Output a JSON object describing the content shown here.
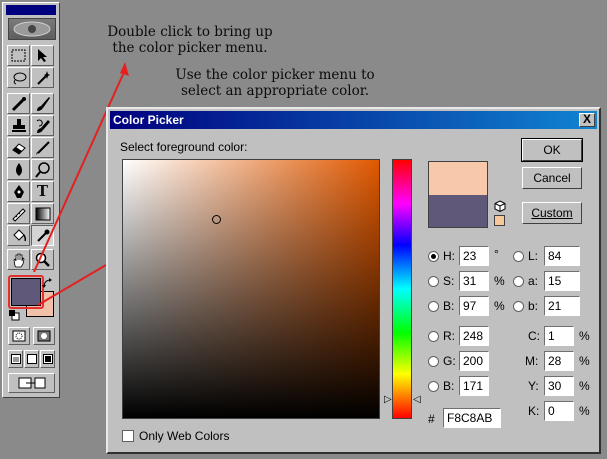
{
  "annotations": {
    "double_click": "Double click to bring up\nthe color picker menu.",
    "use_picker": "Use the color picker menu to\nselect an appropriate color."
  },
  "toolbox": {
    "tools": [
      "marquee-tool",
      "move-tool",
      "lasso-tool",
      "magic-wand-tool",
      "airbrush-tool",
      "paintbrush-tool",
      "rubber-stamp-tool",
      "history-brush-tool",
      "eraser-tool",
      "pencil-tool",
      "blur-tool",
      "dodge-tool",
      "pen-tool",
      "type-tool",
      "measure-tool",
      "gradient-tool",
      "paint-bucket-tool",
      "eyedropper-tool",
      "hand-tool",
      "zoom-tool"
    ],
    "type_tool_glyph": "T"
  },
  "dialog": {
    "title": "Color Picker",
    "close_glyph": "X",
    "prompt": "Select foreground color:",
    "buttons": {
      "ok": "OK",
      "cancel": "Cancel",
      "custom": "Custom"
    },
    "hsb": {
      "h_label": "H:",
      "h_value": "23",
      "h_unit": "°",
      "s_label": "S:",
      "s_value": "31",
      "s_unit": "%",
      "b_label": "B:",
      "b_value": "97",
      "b_unit": "%"
    },
    "rgb": {
      "r_label": "R:",
      "r_value": "248",
      "g_label": "G:",
      "g_value": "200",
      "b_label": "B:",
      "b_value": "171"
    },
    "lab": {
      "l_label": "L:",
      "l_value": "84",
      "a_label": "a:",
      "a_value": "15",
      "b_label": "b:",
      "b_value": "21"
    },
    "cmyk": {
      "c_label": "C:",
      "c_value": "1",
      "c_unit": "%",
      "m_label": "M:",
      "m_value": "28",
      "m_unit": "%",
      "y_label": "Y:",
      "y_value": "30",
      "y_unit": "%",
      "k_label": "K:",
      "k_value": "0",
      "k_unit": "%"
    },
    "hex_label": "#",
    "hex_value": "F8C8AB",
    "web_colors_label": "Only Web Colors",
    "selected_mode": "H",
    "colors": {
      "new": "#F8C8AB",
      "old": "#605878",
      "foreground": "#605878",
      "background": "#F0C0A8"
    }
  }
}
